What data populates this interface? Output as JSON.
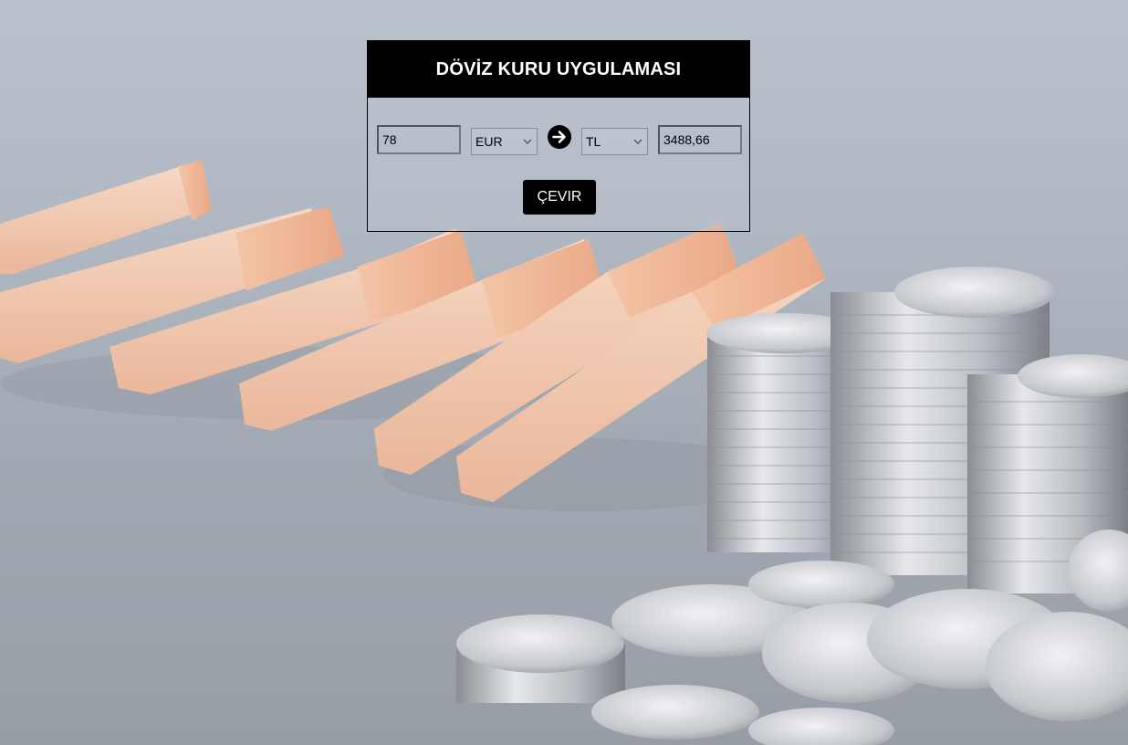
{
  "app": {
    "title": "DÖVİZ KURU UYGULAMASI"
  },
  "converter": {
    "amount_value": "78",
    "from_currency": "EUR",
    "to_currency": "TL",
    "result_value": "3488,66",
    "swap_icon": "arrow-right-circle-icon",
    "convert_label": "ÇEVIR"
  },
  "colors": {
    "header_bg": "#000000",
    "header_text": "#ffffff",
    "button_bg": "#000000",
    "button_text": "#ffffff"
  }
}
